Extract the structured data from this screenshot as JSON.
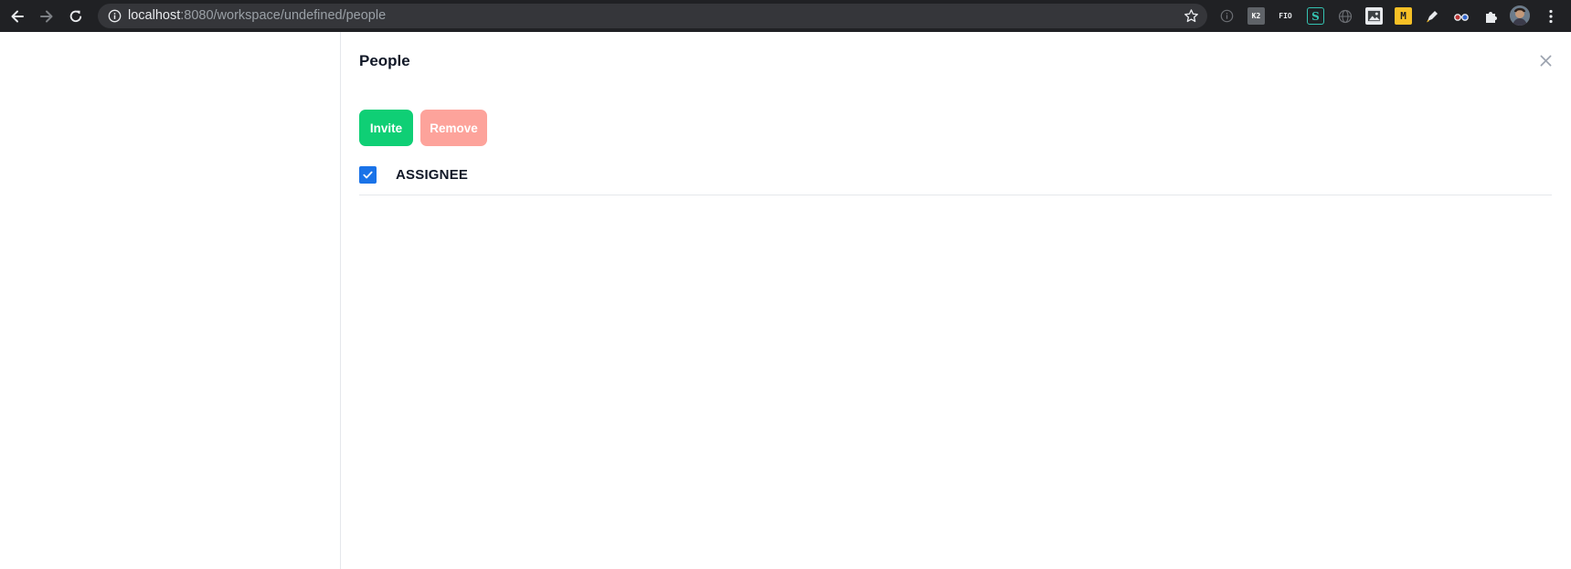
{
  "browser": {
    "url_host": "localhost",
    "url_rest": ":8080/workspace/undefined/people",
    "extensions": [
      {
        "name": "ext-info-icon",
        "text": ""
      },
      {
        "name": "ext-k2-icon",
        "text": "K2"
      },
      {
        "name": "ext-fio-icon",
        "text": "FIO"
      },
      {
        "name": "ext-s-icon",
        "text": "S"
      },
      {
        "name": "ext-globe-icon",
        "text": ""
      },
      {
        "name": "ext-image-icon",
        "text": ""
      },
      {
        "name": "ext-m-icon",
        "text": "M"
      },
      {
        "name": "ext-pen-icon",
        "text": ""
      },
      {
        "name": "ext-glasses-icon",
        "text": ""
      },
      {
        "name": "extensions-puzzle-icon",
        "text": ""
      },
      {
        "name": "profile-avatar",
        "text": ""
      },
      {
        "name": "browser-menu-icon",
        "text": ""
      }
    ]
  },
  "panel": {
    "title": "People",
    "invite_label": "Invite",
    "remove_label": "Remove",
    "header_checkbox_checked": true,
    "column_label": "ASSIGNEE"
  },
  "colors": {
    "invite": "#0fcf75",
    "remove": "#fda39b",
    "checkbox": "#1a73e8"
  }
}
